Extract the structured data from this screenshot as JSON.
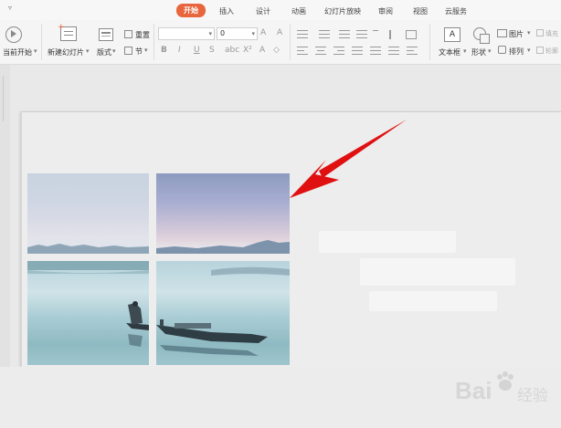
{
  "menu": {
    "tabs": [
      "开始",
      "插入",
      "设计",
      "动画",
      "幻灯片放映",
      "审阅",
      "视图",
      "云服务"
    ],
    "active_tab": "开始"
  },
  "ribbon": {
    "from_start": "当前开始",
    "new_slide": "新建幻灯片",
    "layout": "版式",
    "reset": "重置",
    "section": "节",
    "font_name": "",
    "font_size": "0",
    "text_box": "文本框",
    "shape": "形状",
    "picture": "图片",
    "arrange": "排列",
    "fill": "填充",
    "outline": "轮廓"
  },
  "watermark": {
    "brand": "Bai",
    "suffix": "经验"
  },
  "colors": {
    "accent": "#e8663d",
    "arrow": "#e01010"
  }
}
